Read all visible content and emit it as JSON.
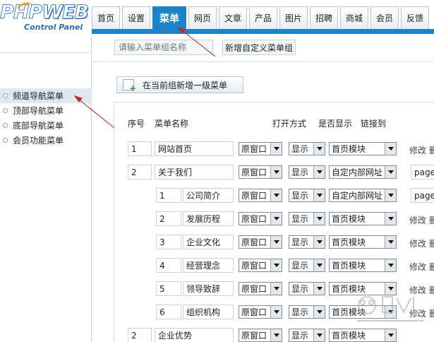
{
  "logo": {
    "part1": "PHP",
    "part2": "WEB",
    "subtitle": "Control Panel"
  },
  "nav": {
    "tabs": [
      "首页",
      "设置",
      "菜单",
      "网页",
      "文章",
      "产品",
      "图片",
      "招聘",
      "商城",
      "会员",
      "反馈"
    ],
    "active": "菜单"
  },
  "sidebar": {
    "items": [
      "频道导航菜单",
      "顶部导航菜单",
      "底部导航菜单",
      "会员功能菜单"
    ],
    "active_index": 0
  },
  "toolbar": {
    "group_name_placeholder": "请输入菜单组名称",
    "add_group_label": "新增自定义菜单组",
    "add_top_menu_label": "在当前组新增一级菜单"
  },
  "table": {
    "headers": {
      "order": "序号",
      "name": "菜单名称",
      "open_mode": "打开方式",
      "visible": "是否显示",
      "link": "链接到"
    },
    "rows": [
      {
        "order": "1",
        "name": "网站首页",
        "open": "原窗口",
        "show": "显示",
        "link": "首页模块",
        "extra": "",
        "actions": "修改 删",
        "level": 1
      },
      {
        "order": "2",
        "name": "关于我们",
        "open": "原窗口",
        "show": "显示",
        "link": "自定内部网址",
        "extra": "page/",
        "actions": "",
        "level": 1
      },
      {
        "order": "1",
        "name": "公司简介",
        "open": "原窗口",
        "show": "显示",
        "link": "自定内部网址",
        "extra": "page/",
        "actions": "",
        "level": 2
      },
      {
        "order": "2",
        "name": "发展历程",
        "open": "原窗口",
        "show": "显示",
        "link": "首页模块",
        "extra": "",
        "actions": "修改 删",
        "level": 2
      },
      {
        "order": "3",
        "name": "企业文化",
        "open": "原窗口",
        "show": "显示",
        "link": "首页模块",
        "extra": "",
        "actions": "修改 删",
        "level": 2
      },
      {
        "order": "4",
        "name": "经营理念",
        "open": "原窗口",
        "show": "显示",
        "link": "首页模块",
        "extra": "",
        "actions": "修改 删",
        "level": 2
      },
      {
        "order": "5",
        "name": "领导致辞",
        "open": "原窗口",
        "show": "显示",
        "link": "首页模块",
        "extra": "",
        "actions": "修改 删",
        "level": 2
      },
      {
        "order": "6",
        "name": "组织机构",
        "open": "原窗口",
        "show": "显示",
        "link": "首页模块",
        "extra": "",
        "actions": "修改 删",
        "level": 2
      },
      {
        "order": "2",
        "name": "企业优势",
        "open": "原窗口",
        "show": "显示",
        "link": "首页模块",
        "extra": "",
        "actions": "",
        "level": 1
      }
    ]
  },
  "colors": {
    "accent": "#1b83c9",
    "annotation": "#c0282a"
  }
}
